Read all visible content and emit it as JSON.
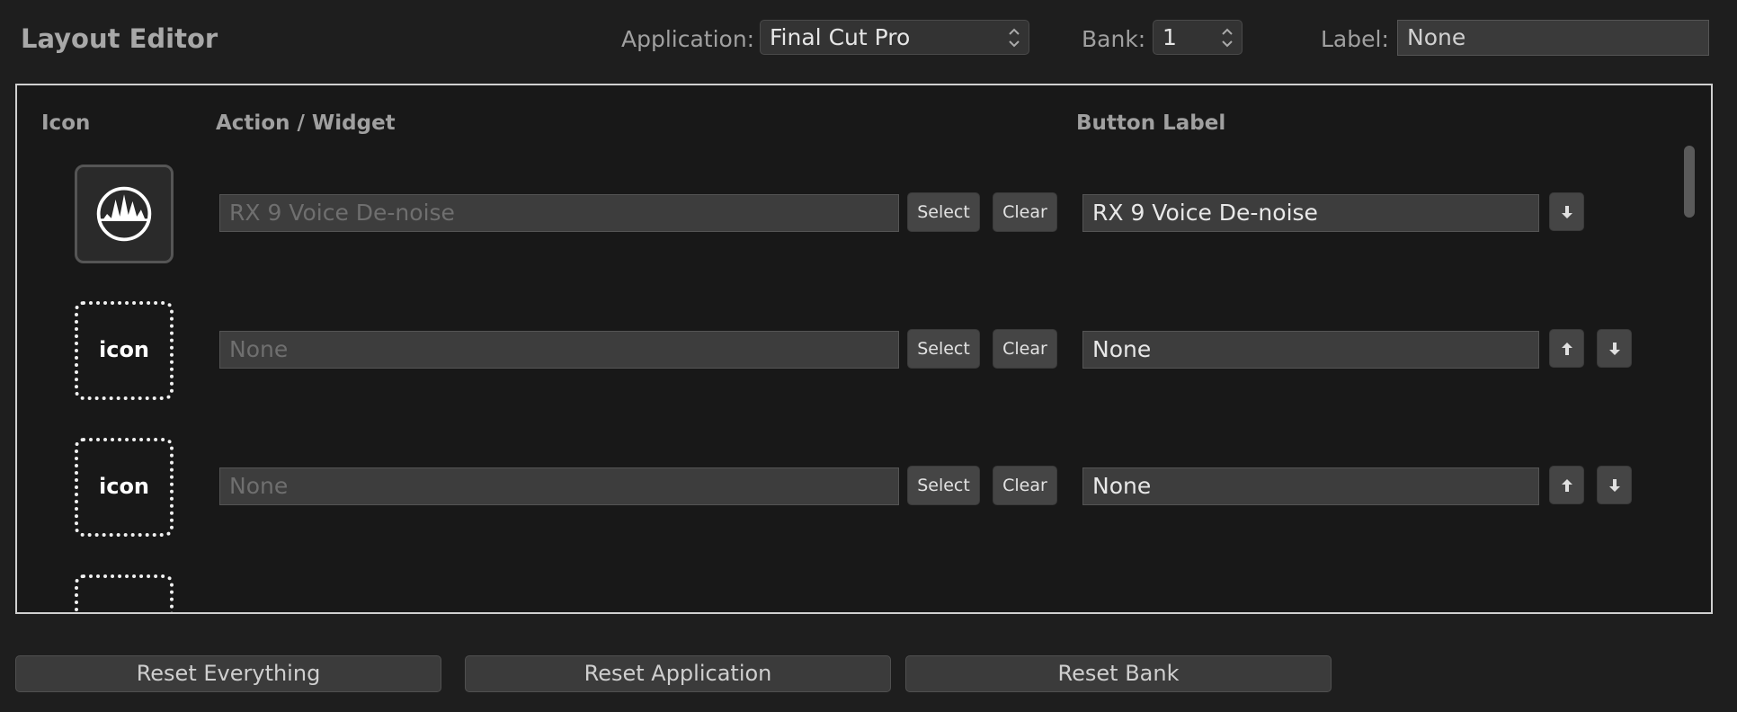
{
  "header": {
    "title": "Layout Editor",
    "application_label": "Application:",
    "application_value": "Final Cut Pro",
    "bank_label": "Bank:",
    "bank_value": "1",
    "label_label": "Label:",
    "label_value": "None"
  },
  "columns": {
    "icon": "Icon",
    "action": "Action / Widget",
    "button_label": "Button Label"
  },
  "rows": [
    {
      "icon_text": "",
      "icon_name": "rx-waveform-icon",
      "action": "RX 9 Voice De-noise",
      "select": "Select",
      "clear": "Clear",
      "label": "RX 9 Voice De-noise"
    },
    {
      "icon_text": "icon",
      "icon_name": "placeholder-icon",
      "action": "None",
      "select": "Select",
      "clear": "Clear",
      "label": "None"
    },
    {
      "icon_text": "icon",
      "icon_name": "placeholder-icon",
      "action": "None",
      "select": "Select",
      "clear": "Clear",
      "label": "None"
    }
  ],
  "footer": {
    "reset_everything": "Reset Everything",
    "reset_application": "Reset Application",
    "reset_bank": "Reset Bank"
  },
  "colors": {
    "background": "#1e1e1e",
    "panel_border": "#d0d0d0"
  }
}
